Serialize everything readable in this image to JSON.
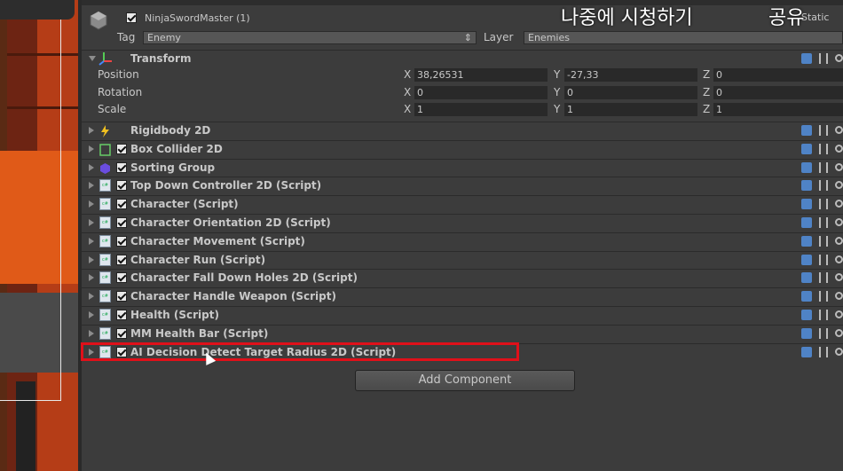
{
  "overlay": {
    "watch_later": "나중에 시청하기",
    "share": "공유"
  },
  "header": {
    "object_name": "NinjaSwordMaster (1)",
    "static_label": "Static",
    "tag_label": "Tag",
    "tag_value": "Enemy",
    "layer_label": "Layer",
    "layer_value": "Enemies"
  },
  "transform": {
    "title": "Transform",
    "rows": [
      {
        "label": "Position",
        "x": "38,26531",
        "y": "-27,33",
        "z": "0"
      },
      {
        "label": "Rotation",
        "x": "0",
        "y": "0",
        "z": "0"
      },
      {
        "label": "Scale",
        "x": "1",
        "y": "1",
        "z": "1"
      }
    ],
    "axis": {
      "x": "X",
      "y": "Y",
      "z": "Z"
    }
  },
  "components": [
    {
      "name": "Rigidbody 2D",
      "icon": "rigidbody-icon",
      "checkbox": false
    },
    {
      "name": "Box Collider 2D",
      "icon": "box-collider-icon",
      "checkbox": true
    },
    {
      "name": "Sorting Group",
      "icon": "sorting-group-icon",
      "checkbox": true
    },
    {
      "name": "Top Down Controller 2D (Script)",
      "icon": "script-icon",
      "checkbox": true
    },
    {
      "name": "Character (Script)",
      "icon": "script-icon",
      "checkbox": true
    },
    {
      "name": "Character Orientation 2D (Script)",
      "icon": "script-icon",
      "checkbox": true
    },
    {
      "name": "Character Movement (Script)",
      "icon": "script-icon",
      "checkbox": true
    },
    {
      "name": "Character Run (Script)",
      "icon": "script-icon",
      "checkbox": true
    },
    {
      "name": "Character Fall Down Holes 2D (Script)",
      "icon": "script-icon",
      "checkbox": true
    },
    {
      "name": "Character Handle Weapon (Script)",
      "icon": "script-icon",
      "checkbox": true
    },
    {
      "name": "Health (Script)",
      "icon": "script-icon",
      "checkbox": true
    },
    {
      "name": "MM Health Bar (Script)",
      "icon": "script-icon",
      "checkbox": true
    },
    {
      "name": "AI Decision Detect Target Radius 2D (Script)",
      "icon": "script-icon",
      "checkbox": true
    }
  ],
  "add_component_label": "Add Component",
  "colors": {
    "highlight": "#e0101a",
    "panel": "#3c3c3c",
    "field": "#292929"
  }
}
